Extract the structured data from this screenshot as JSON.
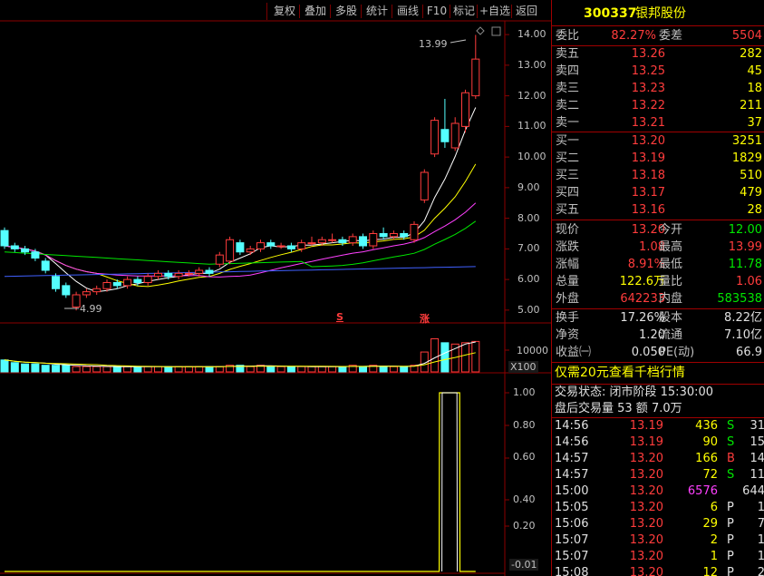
{
  "toolbar": {
    "items": [
      "复权",
      "叠加",
      "多股",
      "统计",
      "画线",
      "F10",
      "标记",
      "+自选",
      "返回"
    ]
  },
  "main_chart": {
    "price_axis": [
      "14.00",
      "13.00",
      "12.00",
      "11.00",
      "10.00",
      "9.00",
      "8.00",
      "7.00",
      "6.00",
      "5.00"
    ],
    "high_label": "13.99",
    "low_label": "4.99",
    "marker_s": "S",
    "marker_zhang": "涨"
  },
  "volume_chart": {
    "axis_value": "10000",
    "unit": "X100"
  },
  "indicator_chart": {
    "axis": [
      "1.00",
      "0.80",
      "0.60",
      "0.40",
      "0.20",
      "-0.01"
    ]
  },
  "chart_data": {
    "type": "candlestick",
    "ylim": [
      4.7,
      14.3
    ],
    "candles": [
      {
        "o": 7.6,
        "c": 7.1,
        "h": 7.7,
        "l": 7.0
      },
      {
        "o": 7.1,
        "c": 7.0,
        "h": 7.2,
        "l": 6.9
      },
      {
        "o": 7.0,
        "c": 6.9,
        "h": 7.1,
        "l": 6.8
      },
      {
        "o": 6.9,
        "c": 6.7,
        "h": 7.0,
        "l": 6.6
      },
      {
        "o": 6.6,
        "c": 6.3,
        "h": 6.7,
        "l": 6.2
      },
      {
        "o": 6.1,
        "c": 5.7,
        "h": 6.2,
        "l": 5.6
      },
      {
        "o": 5.8,
        "c": 5.5,
        "h": 5.9,
        "l": 5.4
      },
      {
        "o": 5.1,
        "c": 5.5,
        "h": 5.6,
        "l": 4.99
      },
      {
        "o": 5.5,
        "c": 5.6,
        "h": 5.7,
        "l": 5.4
      },
      {
        "o": 5.6,
        "c": 5.7,
        "h": 5.8,
        "l": 5.5
      },
      {
        "o": 5.7,
        "c": 5.9,
        "h": 6.0,
        "l": 5.6
      },
      {
        "o": 5.9,
        "c": 5.8,
        "h": 6.0,
        "l": 5.7
      },
      {
        "o": 5.8,
        "c": 6.0,
        "h": 6.1,
        "l": 5.7
      },
      {
        "o": 6.0,
        "c": 5.9,
        "h": 6.1,
        "l": 5.8
      },
      {
        "o": 5.9,
        "c": 6.1,
        "h": 6.2,
        "l": 5.8
      },
      {
        "o": 6.1,
        "c": 6.2,
        "h": 6.3,
        "l": 6.0
      },
      {
        "o": 6.2,
        "c": 6.1,
        "h": 6.3,
        "l": 6.0
      },
      {
        "o": 6.1,
        "c": 6.2,
        "h": 6.3,
        "l": 6.0
      },
      {
        "o": 6.2,
        "c": 6.2,
        "h": 6.3,
        "l": 6.1
      },
      {
        "o": 6.2,
        "c": 6.3,
        "h": 6.4,
        "l": 6.1
      },
      {
        "o": 6.3,
        "c": 6.2,
        "h": 6.4,
        "l": 6.1
      },
      {
        "o": 6.5,
        "c": 6.8,
        "h": 6.9,
        "l": 6.4
      },
      {
        "o": 6.6,
        "c": 7.3,
        "h": 7.4,
        "l": 6.5
      },
      {
        "o": 7.2,
        "c": 6.9,
        "h": 7.3,
        "l": 6.8
      },
      {
        "o": 6.9,
        "c": 7.0,
        "h": 7.1,
        "l": 6.8
      },
      {
        "o": 7.0,
        "c": 7.2,
        "h": 7.3,
        "l": 6.9
      },
      {
        "o": 7.2,
        "c": 7.1,
        "h": 7.3,
        "l": 7.0
      },
      {
        "o": 7.1,
        "c": 7.1,
        "h": 7.2,
        "l": 7.0
      },
      {
        "o": 7.1,
        "c": 7.0,
        "h": 7.2,
        "l": 6.9
      },
      {
        "o": 7.0,
        "c": 7.2,
        "h": 7.3,
        "l": 6.9
      },
      {
        "o": 7.2,
        "c": 7.2,
        "h": 7.4,
        "l": 7.1
      },
      {
        "o": 7.2,
        "c": 7.3,
        "h": 7.4,
        "l": 7.1
      },
      {
        "o": 7.3,
        "c": 7.3,
        "h": 7.5,
        "l": 7.2
      },
      {
        "o": 7.3,
        "c": 7.2,
        "h": 7.4,
        "l": 7.1
      },
      {
        "o": 7.2,
        "c": 7.4,
        "h": 7.5,
        "l": 7.1
      },
      {
        "o": 7.4,
        "c": 7.1,
        "h": 7.5,
        "l": 7.0
      },
      {
        "o": 7.1,
        "c": 7.5,
        "h": 7.6,
        "l": 7.0
      },
      {
        "o": 7.5,
        "c": 7.4,
        "h": 7.7,
        "l": 7.3
      },
      {
        "o": 7.4,
        "c": 7.5,
        "h": 7.6,
        "l": 7.3
      },
      {
        "o": 7.5,
        "c": 7.4,
        "h": 7.6,
        "l": 7.3
      },
      {
        "o": 7.3,
        "c": 7.8,
        "h": 7.9,
        "l": 7.2
      },
      {
        "o": 8.6,
        "c": 9.5,
        "h": 9.6,
        "l": 8.5
      },
      {
        "o": 10.1,
        "c": 11.2,
        "h": 11.3,
        "l": 10.0
      },
      {
        "o": 10.9,
        "c": 10.5,
        "h": 11.9,
        "l": 10.3
      },
      {
        "o": 10.3,
        "c": 11.1,
        "h": 11.3,
        "l": 10.2
      },
      {
        "o": 11.0,
        "c": 12.1,
        "h": 12.2,
        "l": 10.8
      },
      {
        "o": 12.0,
        "c": 13.2,
        "h": 13.99,
        "l": 11.9
      }
    ],
    "volumes": [
      0.9,
      0.7,
      0.6,
      0.6,
      0.5,
      0.5,
      0.5,
      0.4,
      0.4,
      0.4,
      0.4,
      0.4,
      0.4,
      0.4,
      0.4,
      0.4,
      0.4,
      0.4,
      0.4,
      0.4,
      0.4,
      0.4,
      0.5,
      0.5,
      0.4,
      0.5,
      0.4,
      0.4,
      0.4,
      0.4,
      0.4,
      0.4,
      0.4,
      0.4,
      0.5,
      0.4,
      0.5,
      0.4,
      0.4,
      0.4,
      0.5,
      1.5,
      2.5,
      2.2,
      2.1,
      2.2,
      2.3
    ],
    "indicator": [
      0,
      0,
      0,
      0,
      0,
      0,
      0,
      0,
      0,
      0,
      0,
      0,
      0,
      0,
      0,
      0,
      0,
      0,
      0,
      0,
      0,
      0,
      0,
      0,
      0,
      0,
      0,
      0,
      0,
      0,
      0,
      0,
      0,
      0,
      0,
      0,
      0,
      0,
      0,
      0,
      0,
      0,
      0,
      1,
      1,
      0,
      0
    ]
  },
  "quote": {
    "code": "300337",
    "name": "银邦股份",
    "weibi_label": "委比",
    "weibi_value": "82.27%",
    "weicha_label": "委差",
    "weicha_value": "5504",
    "sells": [
      {
        "label": "卖五",
        "price": "13.26",
        "vol": "282"
      },
      {
        "label": "卖四",
        "price": "13.25",
        "vol": "45"
      },
      {
        "label": "卖三",
        "price": "13.23",
        "vol": "18"
      },
      {
        "label": "卖二",
        "price": "13.22",
        "vol": "211"
      },
      {
        "label": "卖一",
        "price": "13.21",
        "vol": "37"
      }
    ],
    "buys": [
      {
        "label": "买一",
        "price": "13.20",
        "vol": "3251"
      },
      {
        "label": "买二",
        "price": "13.19",
        "vol": "1829"
      },
      {
        "label": "买三",
        "price": "13.18",
        "vol": "510"
      },
      {
        "label": "买四",
        "price": "13.17",
        "vol": "479"
      },
      {
        "label": "买五",
        "price": "13.16",
        "vol": "28"
      }
    ],
    "stats": [
      {
        "l1": "现价",
        "v1": "13.20",
        "c1": "red",
        "l2": "今开",
        "v2": "12.00",
        "c2": "green"
      },
      {
        "l1": "涨跌",
        "v1": "1.08",
        "c1": "red",
        "l2": "最高",
        "v2": "13.99",
        "c2": "red"
      },
      {
        "l1": "涨幅",
        "v1": "8.91%",
        "c1": "red",
        "l2": "最低",
        "v2": "11.78",
        "c2": "green"
      },
      {
        "l1": "总量",
        "v1": "122.6万",
        "c1": "yellow",
        "l2": "量比",
        "v2": "1.06",
        "c2": "red"
      },
      {
        "l1": "外盘",
        "v1": "642233",
        "c1": "red",
        "l2": "内盘",
        "v2": "583538",
        "c2": "green"
      }
    ],
    "stats2": [
      {
        "l1": "换手",
        "v1": "17.26%",
        "l2": "股本",
        "v2": "8.22亿"
      },
      {
        "l1": "净资",
        "v1": "1.20",
        "l2": "流通",
        "v2": "7.10亿"
      },
      {
        "l1": "收益㈠",
        "v1": "0.050",
        "l2": "PE(动)",
        "v2": "66.9"
      }
    ],
    "promo": "仅需20元查看千档行情",
    "trade_status": "交易状态: 闭市阶段 15:30:00",
    "after_hours": "盘后交易量 53 额 7.0万",
    "ticks": [
      {
        "t": "14:56",
        "p": "13.19",
        "v": "436",
        "vc": "yellow",
        "d": "S",
        "dc": "green",
        "n": "31"
      },
      {
        "t": "14:56",
        "p": "13.19",
        "v": "90",
        "vc": "yellow",
        "d": "S",
        "dc": "green",
        "n": "15"
      },
      {
        "t": "14:57",
        "p": "13.20",
        "v": "166",
        "vc": "yellow",
        "d": "B",
        "dc": "red",
        "n": "14"
      },
      {
        "t": "14:57",
        "p": "13.20",
        "v": "72",
        "vc": "yellow",
        "d": "S",
        "dc": "green",
        "n": "11"
      },
      {
        "t": "15:00",
        "p": "13.20",
        "v": "6576",
        "vc": "magenta",
        "d": "",
        "dc": "white",
        "n": "644"
      },
      {
        "t": "15:05",
        "p": "13.20",
        "v": "6",
        "vc": "yellow",
        "d": "P",
        "dc": "white",
        "n": "1"
      },
      {
        "t": "15:06",
        "p": "13.20",
        "v": "29",
        "vc": "yellow",
        "d": "P",
        "dc": "white",
        "n": "7"
      },
      {
        "t": "15:07",
        "p": "13.20",
        "v": "2",
        "vc": "yellow",
        "d": "P",
        "dc": "white",
        "n": "1"
      },
      {
        "t": "15:07",
        "p": "13.20",
        "v": "1",
        "vc": "yellow",
        "d": "P",
        "dc": "white",
        "n": "1"
      },
      {
        "t": "15:08",
        "p": "13.20",
        "v": "12",
        "vc": "yellow",
        "d": "P",
        "dc": "white",
        "n": "2"
      }
    ]
  }
}
